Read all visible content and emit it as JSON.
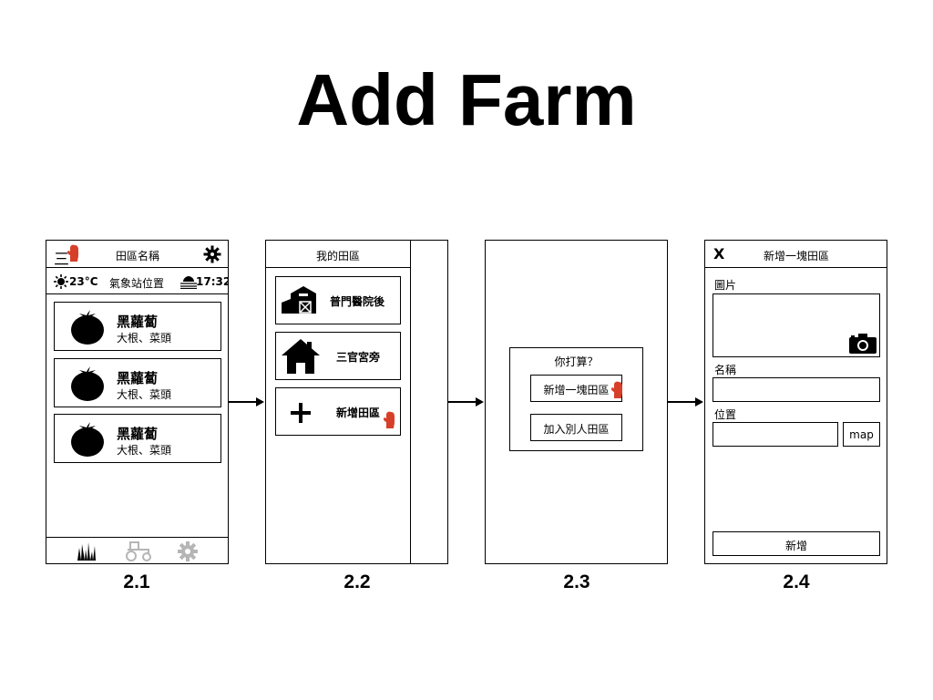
{
  "title": "Add Farm",
  "screens": {
    "s21": {
      "caption": "2.1",
      "header_title": "田區名稱",
      "menu_glyph": "三",
      "weather": {
        "temperature": "23°C",
        "station": "氣象站位置",
        "time": "17:32"
      },
      "crops": [
        {
          "name": "黑蘿蔔",
          "sub": "大根、菜頭"
        },
        {
          "name": "黑蘿蔔",
          "sub": "大根、菜頭"
        },
        {
          "name": "黑蘿蔔",
          "sub": "大根、菜頭"
        }
      ],
      "icons": [
        "glove-icon",
        "gear-icon",
        "sun-icon",
        "fog-icon",
        "tomato-icon",
        "grass-icon",
        "tractor-icon",
        "settings-icon"
      ]
    },
    "s22": {
      "caption": "2.2",
      "header_title": "我的田區",
      "farms": [
        {
          "label": "普門醫院後",
          "icon": "barn-icon"
        },
        {
          "label": "三官宮旁",
          "icon": "house-icon"
        },
        {
          "label": "新增田區",
          "icon": "plus-icon"
        }
      ]
    },
    "s23": {
      "caption": "2.3",
      "dialog_title": "你打算？",
      "option_new": "新增一塊田區",
      "option_join": "加入別人田區"
    },
    "s24": {
      "caption": "2.4",
      "close_label": "X",
      "header_title": "新增一塊田區",
      "image_label": "圖片",
      "name_label": "名稱",
      "location_label": "位置",
      "map_button": "map",
      "submit_button": "新增"
    }
  },
  "colors": {
    "glove": "#d6402a",
    "inactive_icon": "#b5b5b5",
    "line": "#000000"
  }
}
